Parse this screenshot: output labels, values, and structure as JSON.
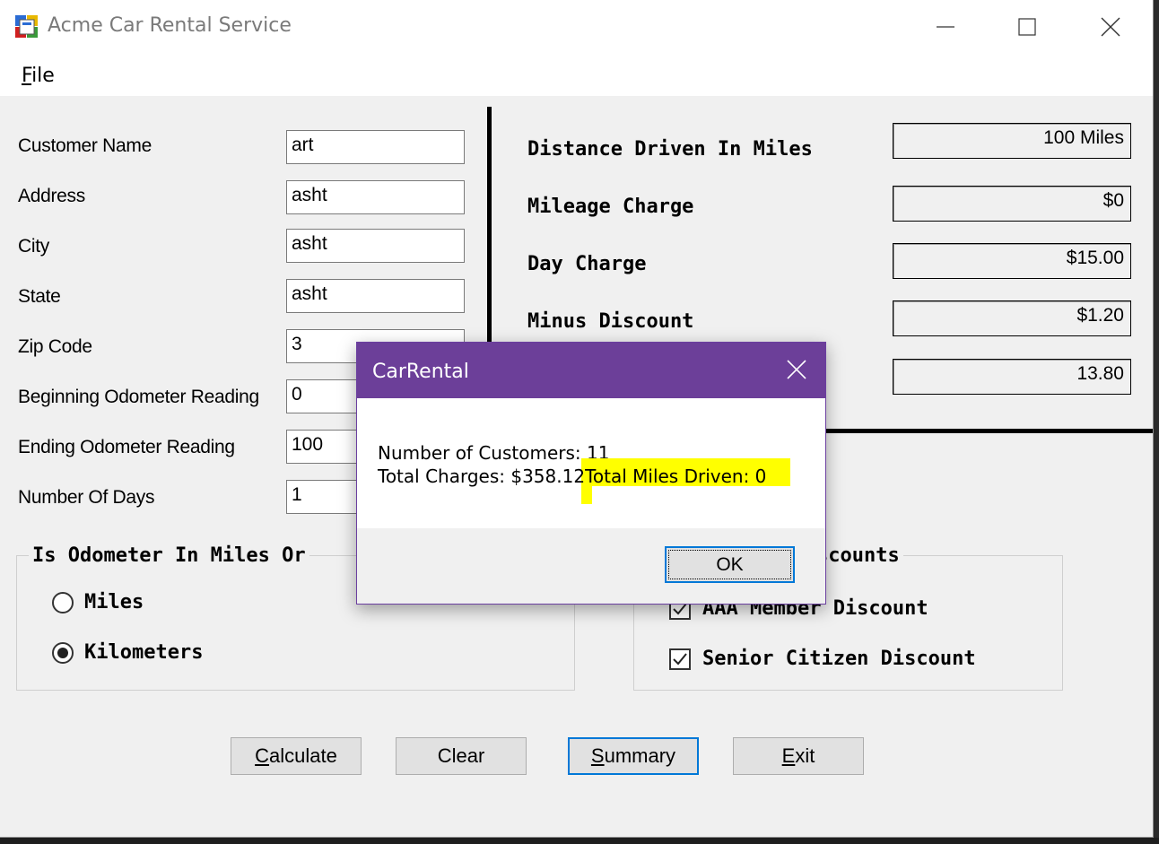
{
  "window": {
    "title": "Acme Car Rental Service"
  },
  "menu": {
    "file_first": "F",
    "file_rest": "ile"
  },
  "form": {
    "fields": [
      {
        "label": "Customer Name",
        "value": "art"
      },
      {
        "label": "Address",
        "value": "asht"
      },
      {
        "label": "City",
        "value": "asht"
      },
      {
        "label": "State",
        "value": "asht"
      },
      {
        "label": "Zip Code",
        "value": "3"
      },
      {
        "label": "Beginning Odometer Reading",
        "value": "0"
      },
      {
        "label": "Ending Odometer Reading",
        "value": "100"
      },
      {
        "label": "Number Of Days",
        "value": "1"
      }
    ]
  },
  "results": {
    "rows": [
      {
        "label": "Distance Driven In Miles",
        "value": "100 Miles"
      },
      {
        "label": "Mileage Charge",
        "value": "$0"
      },
      {
        "label": "Day Charge",
        "value": "$15.00"
      },
      {
        "label": "Minus Discount",
        "value": "$1.20"
      },
      {
        "label": "",
        "value": "13.80"
      }
    ]
  },
  "odometer_group": {
    "title": "Is Odometer In Miles Or",
    "options": [
      {
        "label": "Miles",
        "checked": false
      },
      {
        "label": "Kilometers",
        "checked": true
      }
    ]
  },
  "discount_group": {
    "title": "scounts",
    "options": [
      {
        "label": "AAA Member Discount",
        "checked": true
      },
      {
        "label": "Senior Citizen Discount",
        "checked": true
      }
    ]
  },
  "buttons": {
    "calculate_first": "C",
    "calculate_rest": "alculate",
    "clear": "Clear",
    "summary_first": "S",
    "summary_rest": "ummary",
    "exit_first": "E",
    "exit_rest": "xit"
  },
  "dialog": {
    "title": "CarRental",
    "line1": "Number of Customers: 11",
    "line2_part1": "Total Charges: $358.12",
    "line2_part2": "Total Miles Driven: 0",
    "ok": "OK",
    "highlight_color": "#ffff00",
    "title_color": "#6c3f99"
  }
}
